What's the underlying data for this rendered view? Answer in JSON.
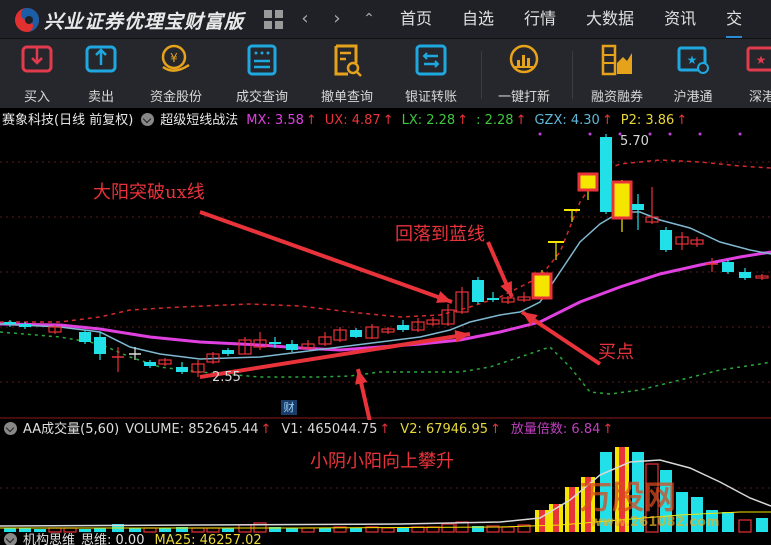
{
  "app": {
    "title": "兴业证券优理宝财富版",
    "nav_icons": [
      "grid-icon",
      "back-icon",
      "forward-icon",
      "collapse-up-icon"
    ],
    "top_tabs": [
      {
        "label": "首页"
      },
      {
        "label": "自选"
      },
      {
        "label": "行情"
      },
      {
        "label": "大数据"
      },
      {
        "label": "资讯"
      },
      {
        "label": "交"
      }
    ]
  },
  "toolbar": {
    "items": [
      {
        "label": "买入",
        "icon": "buy-icon",
        "color": "#e23b4e"
      },
      {
        "label": "卖出",
        "icon": "sell-icon",
        "color": "#1fa8e0"
      },
      {
        "label": "资金股份",
        "icon": "funds-icon",
        "color": "#e6a21b"
      },
      {
        "label": "成交查询",
        "icon": "trade-query-icon",
        "color": "#1fa8e0"
      },
      {
        "label": "撤单查询",
        "icon": "cancel-query-icon",
        "color": "#e6a21b"
      },
      {
        "label": "银证转账",
        "icon": "bank-transfer-icon",
        "color": "#1fa8e0"
      },
      {
        "label": "一键打新",
        "icon": "ipo-icon",
        "color": "#e6a21b"
      },
      {
        "label": "融资融券",
        "icon": "margin-icon",
        "color": "#e6a21b"
      },
      {
        "label": "沪港通",
        "icon": "hk-connect-icon",
        "color": "#1fa8e0"
      },
      {
        "label": "深港",
        "icon": "sz-connect-icon",
        "color": "#e23b4e"
      }
    ]
  },
  "chart": {
    "stock_title": "赛象科技(日线 前复权)",
    "indicator_name": "超级短线战法",
    "indicators": [
      {
        "name": "MX",
        "value": "3.58",
        "color": "#e040e0"
      },
      {
        "name": "UX",
        "value": "4.87",
        "color": "#e8333a"
      },
      {
        "name": "LX",
        "value": "2.28",
        "color": "#3ec63e"
      },
      {
        "name": "",
        "value": "2.28",
        "color": "#3ec63e"
      },
      {
        "name": "GZX",
        "value": "4.30",
        "color": "#5fb8d8"
      },
      {
        "name": "P2",
        "value": "3.86",
        "color": "#e8d83a"
      }
    ],
    "up_arrow": "↑",
    "high_label": "5.70",
    "low_label": "2.55",
    "fin_badge": "财"
  },
  "annotations": {
    "breakout": "大阳突破ux线",
    "pullback": "回落到蓝线",
    "buy_point": "买点",
    "climb": "小阴小阳向上攀升"
  },
  "volume": {
    "name": "AA成交量(5,60)",
    "items": [
      {
        "name": "VOLUME",
        "value": "852645.44",
        "color": "#d8d8d8"
      },
      {
        "name": "V1",
        "value": "465044.75",
        "color": "#d8d8d8"
      },
      {
        "name": "V2",
        "value": "67946.95",
        "color": "#e8d83a"
      },
      {
        "name": "放量倍数",
        "value": "6.84",
        "color": "#c040c0"
      }
    ]
  },
  "bottom_indicator": {
    "name": "机构思维",
    "label": "思维: 0.00",
    "ma": "MA25: 46257.02"
  },
  "colors": {
    "up": "#e8333a",
    "down": "#22e0e8",
    "yellow": "#f5e600",
    "mx": "#e040e0",
    "ux": "#d42a2a",
    "lx": "#2aa83a",
    "gzx": "#7fb8d0"
  }
}
